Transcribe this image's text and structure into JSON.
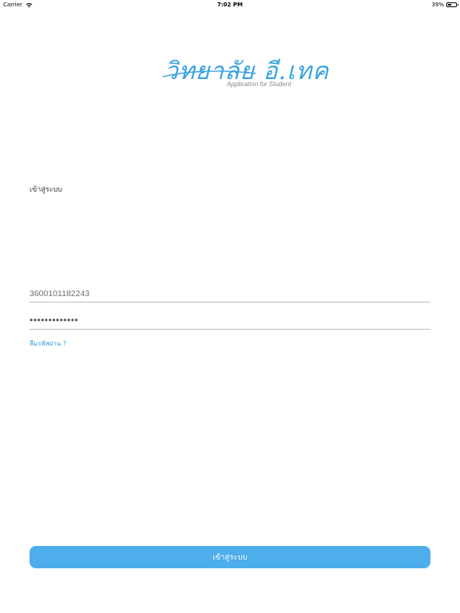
{
  "status_bar": {
    "carrier": "Carrier",
    "time": "7:02 PM",
    "battery_percent": "39%",
    "battery_level": 0.39,
    "wifi_icon": "wifi-icon",
    "battery_icon": "battery-icon"
  },
  "logo": {
    "wordmark": "วิทยาลัย อี.เทค",
    "tagline": "Application for Student",
    "color": "#3aa3dc"
  },
  "page": {
    "heading": "เข้าสู่ระบบ"
  },
  "form": {
    "username_value": "3600101182243",
    "password_value": "•••••••••••••",
    "forgot_password_label": "ลืมรหัสผ่าน ?"
  },
  "actions": {
    "login_label": "เข้าสู่ระบบ",
    "button_color": "#4daeeb",
    "link_color": "#2d9ed8"
  }
}
